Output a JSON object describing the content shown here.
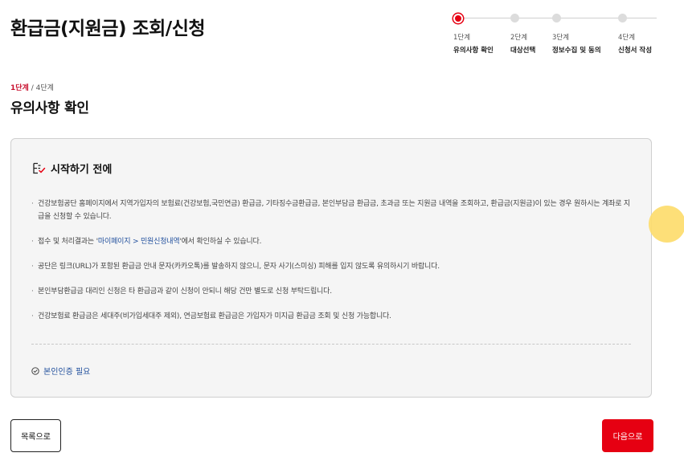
{
  "page": {
    "title": "환급금(지원금) 조회/신청"
  },
  "stepper": {
    "steps": [
      {
        "num": "1단계",
        "name": "유의사항 확인",
        "active": true
      },
      {
        "num": "2단계",
        "name": "대상선택",
        "active": false
      },
      {
        "num": "3단계",
        "name": "정보수집 및 동의",
        "active": false
      },
      {
        "num": "4단계",
        "name": "신청서 작성",
        "active": false
      }
    ]
  },
  "progress": {
    "current": "1단계",
    "separator": " / ",
    "total": "4단계"
  },
  "section": {
    "title": "유의사항 확인"
  },
  "notice": {
    "title": "시작하기 전에",
    "items": [
      "건강보험공단 홈페이지에서 지역가입자의 보험료(건강보험,국민연금) 환급금, 기타징수금환급금, 본인부담금 환급금, 초과금 또는 지원금 내역을 조회하고, 환급금(지원금)이 있는 경우 원하시는 계좌로 지급을 신청할 수 있습니다.",
      {
        "before": "접수 및 처리결과는 '",
        "link": "마이페이지 > 민원신청내역",
        "after": "'에서 확인하실 수 있습니다."
      },
      "공단은 링크(URL)가 포함된 환급금 안내 문자(카카오톡)를 발송하지 않으니, 문자 사기(스미싱) 피해를 입지 않도록 유의하시기 바랍니다.",
      "본인부담환급금 대리인 신청은 타 환급금과 같이 신청이 안되니 해당 건만 별도로 신청 부탁드립니다.",
      "건강보험료 환급금은 세대주(비가입세대주 제외), 연금보험료 환급금은 가입자가 미지급 환급금 조회 및 신청 가능합니다."
    ],
    "auth_required": "본인인증 필요"
  },
  "buttons": {
    "list": "목록으로",
    "next": "다음으로"
  },
  "colors": {
    "accent": "#e60012",
    "link": "#1f4e9c",
    "floating": "#fddc6d"
  },
  "icons": {
    "notice": "checklist-icon",
    "auth": "check-circle-icon"
  }
}
